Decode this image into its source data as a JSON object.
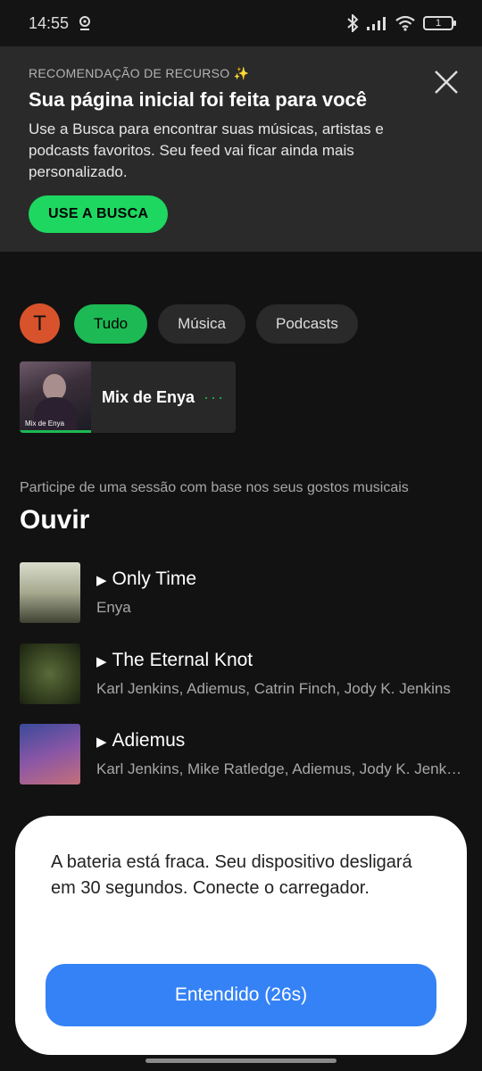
{
  "status_bar": {
    "time": "14:55",
    "battery_level": "1",
    "icons": [
      "location-icon",
      "bluetooth-icon",
      "signal-icon",
      "wifi-icon",
      "battery-icon"
    ]
  },
  "banner": {
    "eyebrow": "RECOMENDAÇÃO DE RECURSO ✨",
    "title": "Sua página inicial foi feita para você",
    "body": "Use a Busca para encontrar suas músicas, artistas e podcasts favoritos. Seu feed vai ficar ainda mais personalizado.",
    "button_label": "USE A BUSCA"
  },
  "profile": {
    "initial": "T",
    "color": "#d8532b"
  },
  "filters": [
    {
      "label": "Tudo",
      "active": true
    },
    {
      "label": "Música",
      "active": false
    },
    {
      "label": "Podcasts",
      "active": false
    }
  ],
  "mix_card": {
    "title": "Mix de Enya",
    "art_caption": "Mix de Enya",
    "more": "···"
  },
  "section": {
    "subtitle": "Participe de uma sessão com base nos seus gostos musicais",
    "title": "Ouvir"
  },
  "tracks": [
    {
      "title": "Only Time",
      "artist": "Enya"
    },
    {
      "title": "The Eternal Knot",
      "artist": "Karl Jenkins, Adiemus, Catrin Finch, Jody K. Jenkins"
    },
    {
      "title": "Adiemus",
      "artist": "Karl Jenkins, Mike Ratledge, Adiemus, Jody K. Jenkins"
    }
  ],
  "dialog": {
    "message": "A bateria está fraca. Seu dispositivo desligará em 30 segundos. Conecte o carregador.",
    "button_label": "Entendido (26s)"
  },
  "colors": {
    "accent": "#1db954",
    "dialog_button": "#3482f6",
    "background": "#121212"
  }
}
